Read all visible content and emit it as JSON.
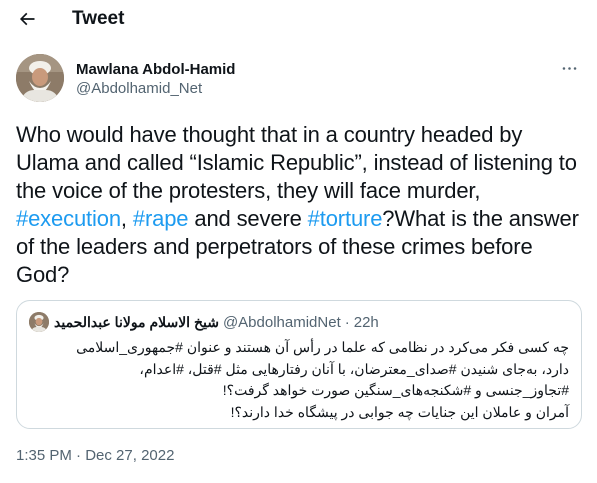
{
  "header": {
    "title": "Tweet",
    "back_icon": "arrow-left-icon"
  },
  "tweet": {
    "author": {
      "name": "Mawlana Abdol-Hamid",
      "handle": "@Abdolhamid_Net"
    },
    "more_icon": "more-horizontal-icon",
    "text": {
      "part1": "Who would have thought that in a country headed by Ulama and called “Islamic Republic”, instead of listening to the voice of the protesters, they will face murder, ",
      "tag1": "#execution",
      "sep1": ", ",
      "tag2": "#rape",
      "sep2": " and severe ",
      "tag3": "#torture",
      "part2": "?What is the answer of the leaders and perpetrators of these crimes before God?"
    },
    "quoted": {
      "name": "شیخ الاسلام مولانا عبدالحمید",
      "handle": "@AbdolhamidNet",
      "separator": "·",
      "time": "22h",
      "lines": [
        "چه کسی فکر می‌کرد در نظامی که علما در رأس آن هستند و عنوان #جمهوری_اسلامی",
        "دارد، به‌جای شنیدن #صدای_معترضان، با آنان رفتارهایی مثل #قتل، #اعدام،",
        "#تجاوز_جنسی و #شکنجه‌های_سنگین صورت خواهد گرفت؟!",
        "آمران و عاملان این جنایات چه جوابی در پیشگاه خدا دارند؟!"
      ]
    },
    "time": "1:35 PM",
    "separator": "·",
    "date": "Dec 27, 2022"
  },
  "colors": {
    "link": "#1d9bf0",
    "text": "#0f1419",
    "secondary": "#536471",
    "border": "#cfd9de"
  }
}
